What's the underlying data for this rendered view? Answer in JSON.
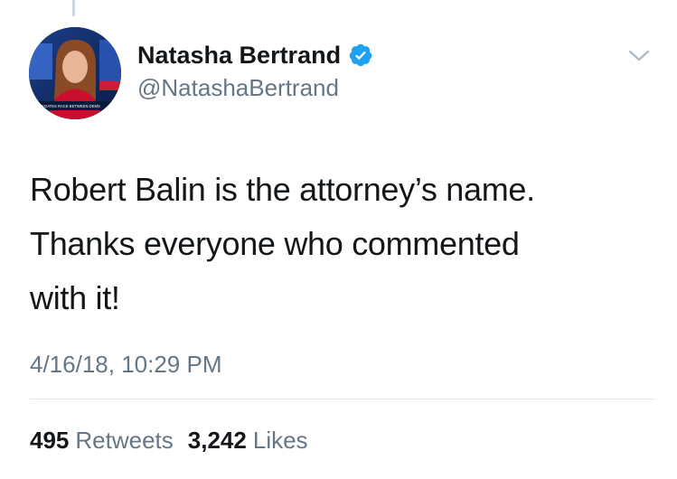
{
  "author": {
    "display_name": "Natasha Bertrand",
    "handle": "@NatashaBertrand",
    "verified": true,
    "avatar_caption": "DELEGATES RACE BETWEEN DEMS"
  },
  "tweet": {
    "text": "Robert Balin is the attorney’s name.\nThanks everyone who commented\nwith it!",
    "timestamp": "4/16/18, 10:29 PM"
  },
  "stats": {
    "retweets_count": "495",
    "retweets_label": "Retweets",
    "likes_count": "3,242",
    "likes_label": "Likes"
  },
  "icons": {
    "verified": "verified-badge-icon",
    "menu": "chevron-down-icon"
  },
  "colors": {
    "text_primary": "#14171a",
    "text_secondary": "#657786",
    "verified_blue": "#1da1f2",
    "divider": "#e1e8ed"
  }
}
